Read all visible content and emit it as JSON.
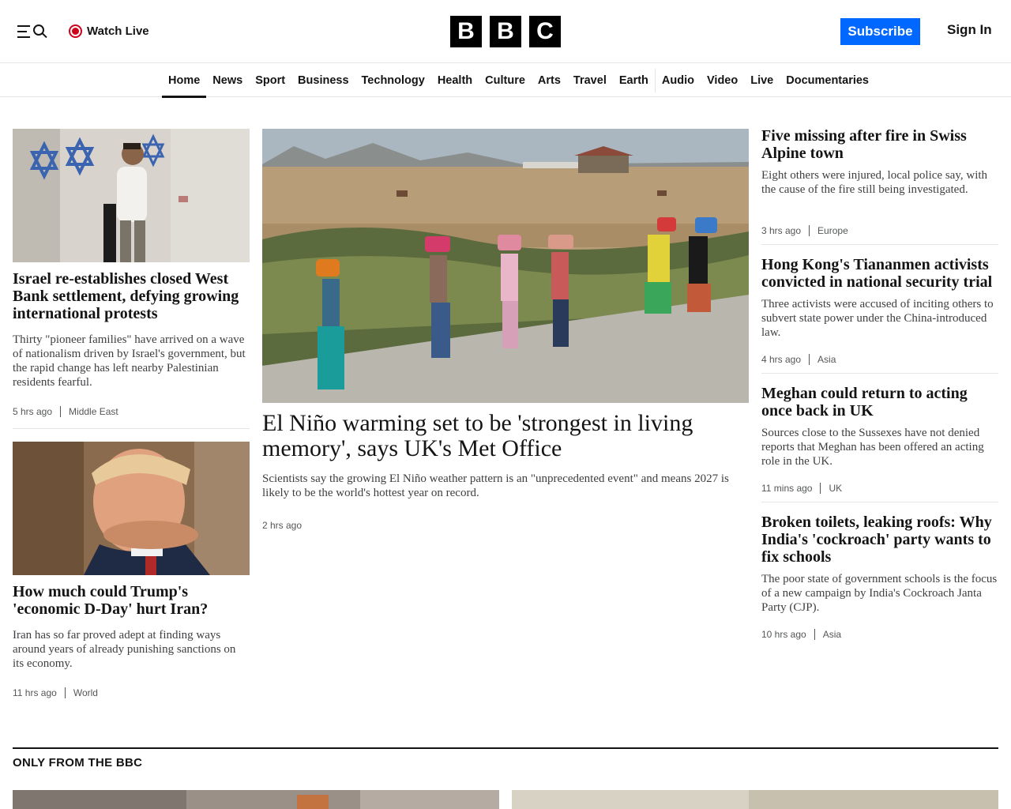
{
  "header": {
    "watch_live": "Watch Live",
    "logo": [
      "B",
      "B",
      "C"
    ],
    "subscribe": "Subscribe",
    "sign_in": "Sign In"
  },
  "nav": {
    "items": [
      "Home",
      "News",
      "Sport",
      "Business",
      "Technology",
      "Health",
      "Culture",
      "Arts",
      "Travel",
      "Earth",
      "Audio",
      "Video",
      "Live",
      "Documentaries"
    ],
    "active": "Home"
  },
  "left": {
    "story1": {
      "headline": "Israel re-establishes closed West Bank settlement, defying growing international protests",
      "summary": "Thirty \"pioneer families\" have arrived on a wave of nationalism driven by Israel's government, but the rapid change has left nearby Palestinian residents fearful.",
      "time": "5 hrs ago",
      "section": "Middle East"
    },
    "story2": {
      "headline": "How much could Trump's 'economic D-Day' hurt Iran?",
      "summary": "Iran has so far proved adept at finding ways around years of already punishing sanctions on its economy.",
      "time": "11 hrs ago",
      "section": "World"
    }
  },
  "center": {
    "headline": "El Niño warming set to be 'strongest in living memory', says UK's Met Office",
    "summary": "Scientists say the growing El Niño weather pattern is an \"unprecedented event\" and means 2027 is likely to be the world's hottest year on record.",
    "time": "2 hrs ago"
  },
  "right": {
    "stories": [
      {
        "headline": "Five missing after fire in Swiss Alpine town",
        "summary": "Eight others were injured, local police say, with the cause of the fire still being investigated.",
        "time": "3 hrs ago",
        "section": "Europe"
      },
      {
        "headline": "Hong Kong's Tiananmen activists convicted in national security trial",
        "summary": "Three activists were accused of inciting others to subvert state power under the China-introduced law.",
        "time": "4 hrs ago",
        "section": "Asia"
      },
      {
        "headline": "Meghan could return to acting once back in UK",
        "summary": "Sources close to the Sussexes have not denied reports that Meghan has been offered an acting role in the UK.",
        "time": "11 mins ago",
        "section": "UK"
      },
      {
        "headline": "Broken toilets, leaking roofs: Why India's 'cockroach' party wants to fix schools",
        "summary": "The poor state of government schools is the focus of a new campaign by India's Cockroach Janta Party (CJP).",
        "time": "10 hrs ago",
        "section": "Asia"
      }
    ]
  },
  "only_from": {
    "title": "ONLY FROM THE BBC"
  },
  "colors": {
    "accent": "#0068ff",
    "live": "#d0021b",
    "text": "#141414"
  }
}
